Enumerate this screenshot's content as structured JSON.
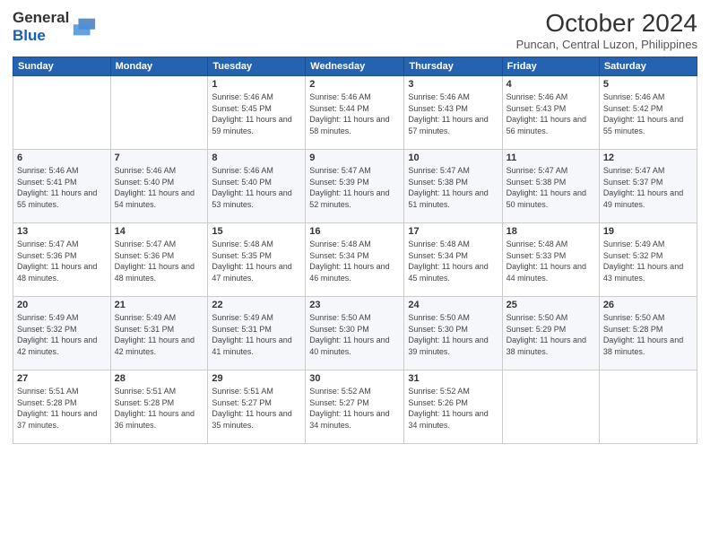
{
  "header": {
    "logo_line1": "General",
    "logo_line2": "Blue",
    "month": "October 2024",
    "location": "Puncan, Central Luzon, Philippines"
  },
  "weekdays": [
    "Sunday",
    "Monday",
    "Tuesday",
    "Wednesday",
    "Thursday",
    "Friday",
    "Saturday"
  ],
  "weeks": [
    [
      {
        "day": "",
        "detail": ""
      },
      {
        "day": "",
        "detail": ""
      },
      {
        "day": "1",
        "detail": "Sunrise: 5:46 AM\nSunset: 5:45 PM\nDaylight: 11 hours and 59 minutes."
      },
      {
        "day": "2",
        "detail": "Sunrise: 5:46 AM\nSunset: 5:44 PM\nDaylight: 11 hours and 58 minutes."
      },
      {
        "day": "3",
        "detail": "Sunrise: 5:46 AM\nSunset: 5:43 PM\nDaylight: 11 hours and 57 minutes."
      },
      {
        "day": "4",
        "detail": "Sunrise: 5:46 AM\nSunset: 5:43 PM\nDaylight: 11 hours and 56 minutes."
      },
      {
        "day": "5",
        "detail": "Sunrise: 5:46 AM\nSunset: 5:42 PM\nDaylight: 11 hours and 55 minutes."
      }
    ],
    [
      {
        "day": "6",
        "detail": "Sunrise: 5:46 AM\nSunset: 5:41 PM\nDaylight: 11 hours and 55 minutes."
      },
      {
        "day": "7",
        "detail": "Sunrise: 5:46 AM\nSunset: 5:40 PM\nDaylight: 11 hours and 54 minutes."
      },
      {
        "day": "8",
        "detail": "Sunrise: 5:46 AM\nSunset: 5:40 PM\nDaylight: 11 hours and 53 minutes."
      },
      {
        "day": "9",
        "detail": "Sunrise: 5:47 AM\nSunset: 5:39 PM\nDaylight: 11 hours and 52 minutes."
      },
      {
        "day": "10",
        "detail": "Sunrise: 5:47 AM\nSunset: 5:38 PM\nDaylight: 11 hours and 51 minutes."
      },
      {
        "day": "11",
        "detail": "Sunrise: 5:47 AM\nSunset: 5:38 PM\nDaylight: 11 hours and 50 minutes."
      },
      {
        "day": "12",
        "detail": "Sunrise: 5:47 AM\nSunset: 5:37 PM\nDaylight: 11 hours and 49 minutes."
      }
    ],
    [
      {
        "day": "13",
        "detail": "Sunrise: 5:47 AM\nSunset: 5:36 PM\nDaylight: 11 hours and 48 minutes."
      },
      {
        "day": "14",
        "detail": "Sunrise: 5:47 AM\nSunset: 5:36 PM\nDaylight: 11 hours and 48 minutes."
      },
      {
        "day": "15",
        "detail": "Sunrise: 5:48 AM\nSunset: 5:35 PM\nDaylight: 11 hours and 47 minutes."
      },
      {
        "day": "16",
        "detail": "Sunrise: 5:48 AM\nSunset: 5:34 PM\nDaylight: 11 hours and 46 minutes."
      },
      {
        "day": "17",
        "detail": "Sunrise: 5:48 AM\nSunset: 5:34 PM\nDaylight: 11 hours and 45 minutes."
      },
      {
        "day": "18",
        "detail": "Sunrise: 5:48 AM\nSunset: 5:33 PM\nDaylight: 11 hours and 44 minutes."
      },
      {
        "day": "19",
        "detail": "Sunrise: 5:49 AM\nSunset: 5:32 PM\nDaylight: 11 hours and 43 minutes."
      }
    ],
    [
      {
        "day": "20",
        "detail": "Sunrise: 5:49 AM\nSunset: 5:32 PM\nDaylight: 11 hours and 42 minutes."
      },
      {
        "day": "21",
        "detail": "Sunrise: 5:49 AM\nSunset: 5:31 PM\nDaylight: 11 hours and 42 minutes."
      },
      {
        "day": "22",
        "detail": "Sunrise: 5:49 AM\nSunset: 5:31 PM\nDaylight: 11 hours and 41 minutes."
      },
      {
        "day": "23",
        "detail": "Sunrise: 5:50 AM\nSunset: 5:30 PM\nDaylight: 11 hours and 40 minutes."
      },
      {
        "day": "24",
        "detail": "Sunrise: 5:50 AM\nSunset: 5:30 PM\nDaylight: 11 hours and 39 minutes."
      },
      {
        "day": "25",
        "detail": "Sunrise: 5:50 AM\nSunset: 5:29 PM\nDaylight: 11 hours and 38 minutes."
      },
      {
        "day": "26",
        "detail": "Sunrise: 5:50 AM\nSunset: 5:28 PM\nDaylight: 11 hours and 38 minutes."
      }
    ],
    [
      {
        "day": "27",
        "detail": "Sunrise: 5:51 AM\nSunset: 5:28 PM\nDaylight: 11 hours and 37 minutes."
      },
      {
        "day": "28",
        "detail": "Sunrise: 5:51 AM\nSunset: 5:28 PM\nDaylight: 11 hours and 36 minutes."
      },
      {
        "day": "29",
        "detail": "Sunrise: 5:51 AM\nSunset: 5:27 PM\nDaylight: 11 hours and 35 minutes."
      },
      {
        "day": "30",
        "detail": "Sunrise: 5:52 AM\nSunset: 5:27 PM\nDaylight: 11 hours and 34 minutes."
      },
      {
        "day": "31",
        "detail": "Sunrise: 5:52 AM\nSunset: 5:26 PM\nDaylight: 11 hours and 34 minutes."
      },
      {
        "day": "",
        "detail": ""
      },
      {
        "day": "",
        "detail": ""
      }
    ]
  ]
}
